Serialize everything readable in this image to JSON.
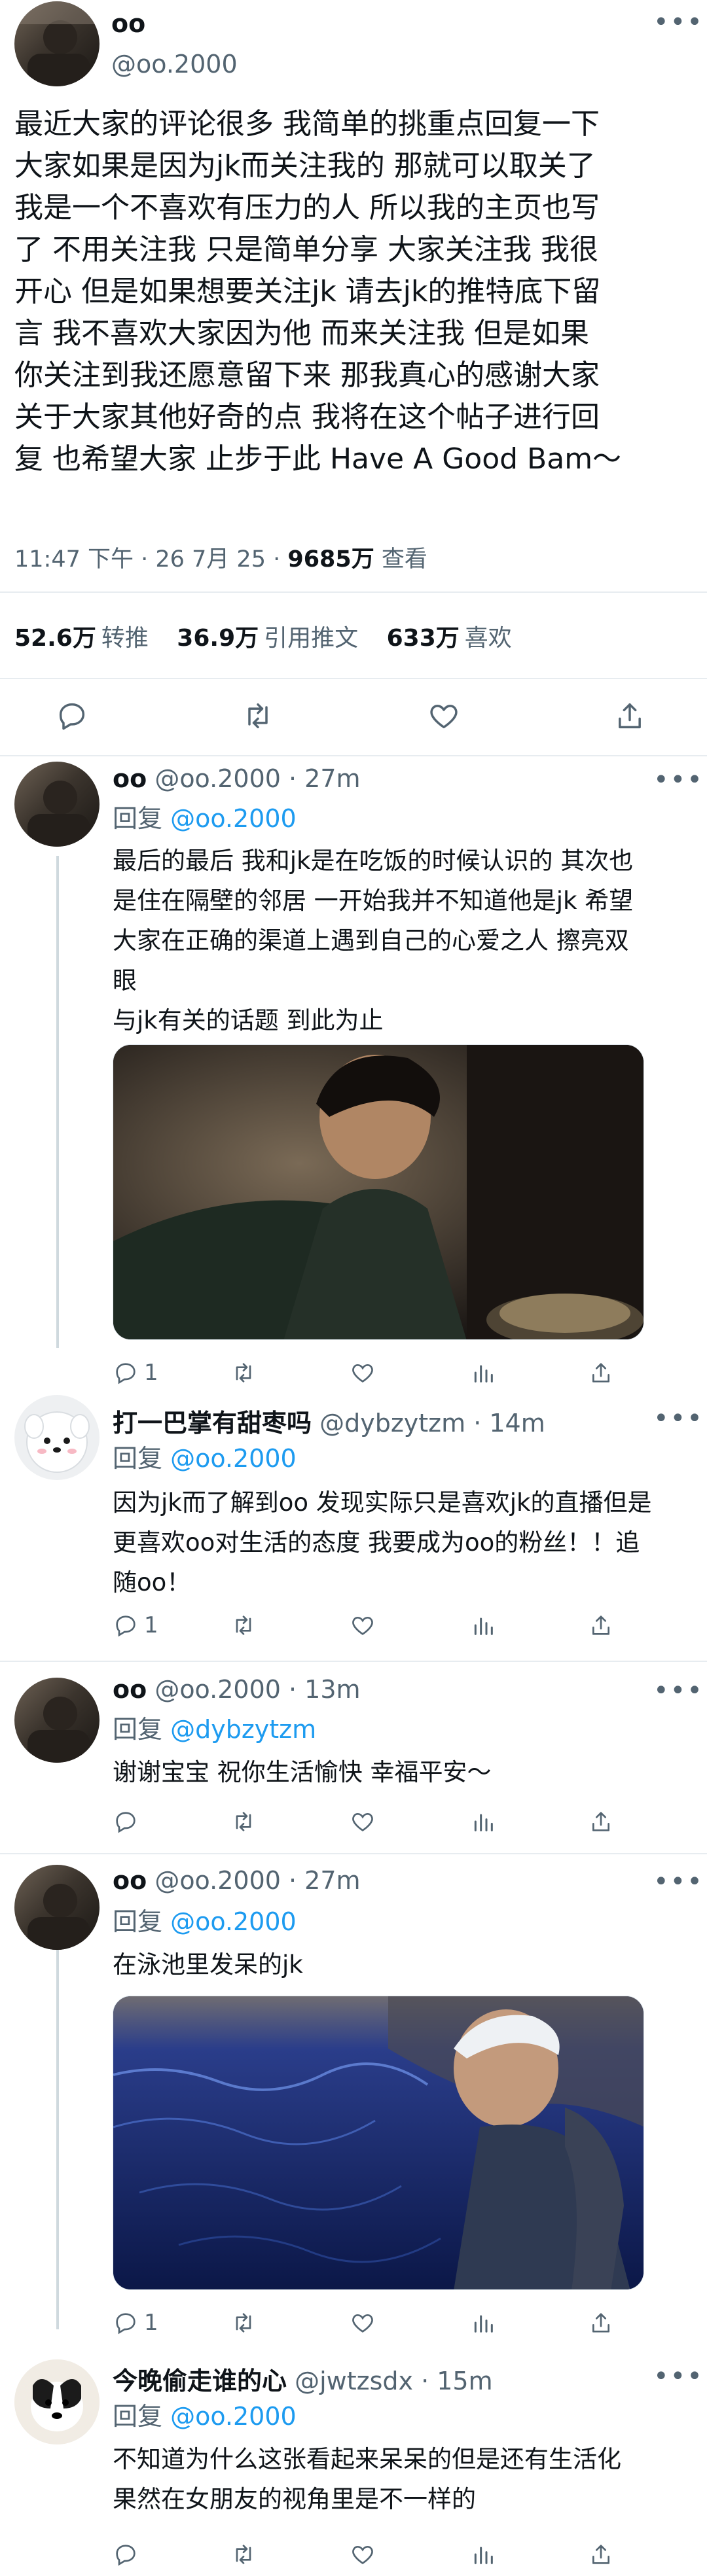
{
  "main_tweet": {
    "display_name": "oo",
    "handle": "@oo.2000",
    "text": "最近大家的评论很多 我简单的挑重点回复一下\n大家如果是因为jk而关注我的 那就可以取关了\n我是一个不喜欢有压力的人 所以我的主页也写\n了 不用关注我 只是简单分享 大家关注我 我很\n开心 但是如果想要关注jk 请去jk的推特底下留\n言 我不喜欢大家因为他 而来关注我 但是如果\n你关注到我还愿意留下来 那我真心的感谢大家\n关于大家其他好奇的点 我将在这个帖子进行回\n复 也希望大家 止步于此 Have A Good Bam～",
    "time": "11:47 下午 · 26 7月 25 · ",
    "views": "9685万",
    "views_label": " 查看",
    "retweets": "52.6万",
    "retweets_label": "转推",
    "quotes": "36.9万",
    "quotes_label": "引用推文",
    "likes": "633万",
    "likes_label": "喜欢"
  },
  "replies": [
    {
      "display_name": "oo",
      "handle": "@oo.2000 · 27m",
      "reply_prefix": "回复 ",
      "reply_to": "@oo.2000",
      "text": "最后的最后 我和jk是在吃饭的时候认识的 其次也\n是住在隔壁的邻居 一开始我并不知道他是jk 希望\n大家在正确的渠道上遇到自己的心爱之人 擦亮双\n眼\n与jk有关的话题 到此为止",
      "reply_count": "1"
    },
    {
      "display_name": "打一巴掌有甜枣吗",
      "handle": "@dybzytzm · 14m",
      "reply_prefix": "回复 ",
      "reply_to": "@oo.2000",
      "text": "因为jk而了解到oo 发现实际只是喜欢jk的直播但是\n更喜欢oo对生活的态度 我要成为oo的粉丝！！追\n随oo！",
      "reply_count": "1"
    },
    {
      "display_name": "oo",
      "handle": "@oo.2000 · 13m",
      "reply_prefix": "回复 ",
      "reply_to": "@dybzytzm",
      "text": "谢谢宝宝 祝你生活愉快 幸福平安～",
      "reply_count": ""
    },
    {
      "display_name": "oo",
      "handle": "@oo.2000 · 27m",
      "reply_prefix": "回复 ",
      "reply_to": "@oo.2000",
      "text": "在泳池里发呆的jk",
      "reply_count": "1"
    },
    {
      "display_name": "今晚偷走谁的心",
      "handle": "@jwtzsdx · 15m",
      "reply_prefix": "回复 ",
      "reply_to": "@oo.2000",
      "text": "不知道为什么这张看起来呆呆的但是还有生活化\n果然在女朋友的视角里是不一样的",
      "reply_count": ""
    }
  ],
  "icons": {
    "reply": "reply-icon",
    "retweet": "retweet-icon",
    "like": "like-icon",
    "views": "views-icon",
    "share": "share-icon",
    "more": "more-icon"
  },
  "colors": {
    "accent": "#1d9bf0",
    "text": "#0f1419",
    "secondary": "#536471",
    "divider": "#e7ecf0"
  }
}
